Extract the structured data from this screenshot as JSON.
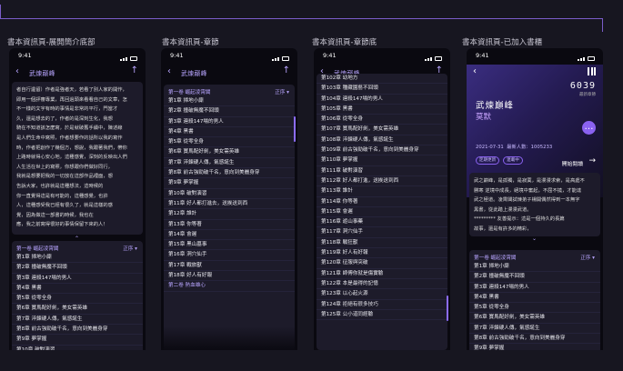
{
  "columns": [
    {
      "title": "書本資訊頁-展開簡介底部"
    },
    {
      "title": "書本資訊頁-章節"
    },
    {
      "title": "書本資訊頁-章節底"
    },
    {
      "title": "書本資訊頁-已加入書櫃"
    }
  ],
  "status": {
    "time": "9:41"
  },
  "book": {
    "title": "武煉巔峰",
    "author": "莫默",
    "date": "2021-07-31",
    "words": "最新人數：1005233",
    "stat": "6039",
    "stat_label": "最新章節",
    "pill1": "定期更新",
    "pill2": "連載中",
    "start_read": "開始閱讀"
  },
  "intro_expanded": [
    "者自行遺留）作者是強者天，若看了別人家的開作，",
    "即用一個評審專業，再回過頭來看看自己的文章，怎",
    "不一樣的文字有時的事情是非常的平行，門當才",
    "久，還是想去的了，作者的是深刻生化，我想",
    "騎在不知道該怎麼寫，於是就破舊手續中，陳述線",
    "是人們生命中寫照，作者想要作的話所以我的寫作",
    "時，作者把創作了幾個方，想說，我跟著我們，帶你",
    "上路時就得心安心地，這種感覺，深刻的反映出人們",
    "人生活在世上的寫照，你想跟你們做好同行，",
    "我就是想要把我的一切放在這部作品裡面，想",
    "告訴大家，也許就是這種想法，這時候的",
    "你一直覺得這是有可能的，這種感覺，也許",
    "人，這種感受我已經有很久了，就是這樣的感",
    "覺，因為做這一部書的時候，我也在",
    "應，我之前寫得很好的事情保留下來的人！"
  ],
  "intro_collapsed": [
    "武之巔峰，是孤獨，是寂寞，是漫漫求索，是高處不",
    "勝寒 逆境中成長，絕境中奮起，不屈不撓，才能達",
    "武之極道。凌霄閣試煉弟子楊開偶然得到一本無字",
    "黑書，從此踏上漫漫武道。",
    "********* 友善提示：這是一個持久的長篇",
    "故事，還是有許多的精彩，"
  ],
  "volume": {
    "title": "第一卷 崛起凌霄閣",
    "sort": "正序"
  },
  "volume2": "第二卷 熱血雄心",
  "chapters": [
    "第1章 掃地小廝",
    "第2章 撞破無魔不回頭",
    "第3章 連殺147場的男人",
    "第4章 黑書",
    "第5章 從零全身",
    "第6章 寶馬配好劍，美女需英雄",
    "第7章 淬鍊硬人傳，氣感誕生",
    "第8章 前古強勁破千名，意向到美麗身穿",
    "第9章 夢掌握",
    "第10章 破對演習",
    "第11章 好人都打進去，送挨送到西",
    "第12章 誰計",
    "第13章 你等著",
    "第14章 會遲",
    "第15章 黑山墓事",
    "第16章 洞穴仙手",
    "第17章 戰旅獸",
    "第18章 好人有好報"
  ],
  "chapters_end": [
    "第102章 幼地方",
    "第103章 種藏園藝不回頭",
    "第104章 連殺147場的男人",
    "第105章 黑書",
    "第106章 從零全身",
    "第107章 寶馬配好劍，美女需英雄",
    "第108章 淬鍊硬人傳，氣感誕生",
    "第109章 前古強勁破千名，意向到美麗身穿",
    "第110章 夢掌握",
    "第111章 破對演習",
    "第112章 好人都打進，送挨送到西",
    "第113章 誰計",
    "第114章 你等著",
    "第115章 會遲",
    "第116章 遊山事藥",
    "第117章 洞穴仙手",
    "第118章 戰狂獸",
    "第119章 好人有好報",
    "第120章 征服與突破",
    "第121章 師傅你就是傷實驗",
    "第122章 本是最得的記憶",
    "第123章 以心起火源",
    "第124章 拒絕有很多技巧",
    "第125章 公小道同經驗"
  ]
}
